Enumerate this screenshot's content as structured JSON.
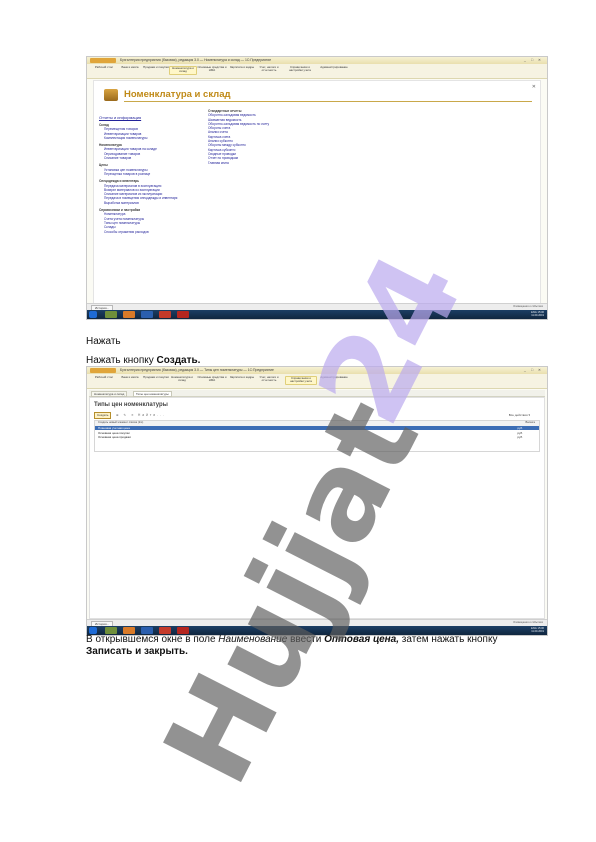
{
  "screenshot1": {
    "window_title": "Бухгалтерия предприятия (базовая), редакция 3.0 — Номенклатура и склад — 1С:Предприятие",
    "sections": [
      "Рабочий стол",
      "Банк и касса",
      "Продажи и покупки",
      "Номенклатура и склад",
      "Основные средства и НМА",
      "Зарплата и кадры",
      "Учет, налоги и отчетность",
      "Справочники и настройки учета",
      "Администрирование"
    ],
    "page_title": "Номенклатура и склад",
    "left_column": {
      "top_link": "Отчеты и информация",
      "groups": [
        {
          "heading": "Склад",
          "items": [
            "Перемещения товаров",
            "Инвентаризации товаров",
            "Комплектация номенклатуры"
          ]
        },
        {
          "heading": "Номенклатура",
          "items": [
            "Инвентаризация товаров на складе",
            "Оприходование товаров",
            "Списание товаров"
          ]
        },
        {
          "heading": "Цены",
          "items": [
            "Установка цен номенклатуры",
            "Переоценка товаров в рознице"
          ]
        },
        {
          "heading": "Спецодежда и инвентарь",
          "items": [
            "Передача материалов в эксплуатацию",
            "Возврат материалов из эксплуатации",
            "Списание материалов из эксплуатации",
            "Передача в помещения спецодежды и инвентаря",
            "Выработка материалов"
          ]
        },
        {
          "heading": "Справочники и настройки",
          "items": [
            "Номенклатура",
            "Счета учета номенклатуры",
            "Типы цен номенклатуры",
            "Склады",
            "Способы отражения расходов"
          ]
        }
      ]
    },
    "right_column": {
      "heading": "Стандартные отчеты",
      "items": [
        "Оборотно-сальдовая ведомость",
        "Шахматная ведомость",
        "Оборотно-сальдовая ведомость по счету",
        "Обороты счета",
        "Анализ счета",
        "Карточка счета",
        "Анализ субконто",
        "Обороты между субконто",
        "Карточка субконто",
        "Сводные проводки",
        "Отчет по проводкам",
        "Главная книга"
      ]
    },
    "status_left": "История...",
    "status_right": "Оповещения о событиях",
    "tray": {
      "lang": "ENG",
      "time": "15:06",
      "date": "11.09.2019"
    }
  },
  "para1": "Нажать",
  "para2": {
    "before": "Нажать кнопку ",
    "bold": "Создать."
  },
  "screenshot2": {
    "window_title": "Бухгалтерия предприятия (базовая), редакция 3.0 — Типы цен номенклатуры — 1С:Предприятие",
    "sections": [
      "Рабочий стол",
      "Банк и касса",
      "Продажи и покупки",
      "Номенклатура и склад",
      "Основные средства и НМА",
      "Зарплата и кадры",
      "Учет, налоги и отчетность",
      "Справочники и настройки учета",
      "Администрирование"
    ],
    "tabs": [
      "Номенклатура и склад",
      "Типы цен номенклатуры"
    ],
    "form_title": "Типы цен номенклатуры",
    "create_button": "Создать",
    "find_label": "Найти...",
    "more_label": "Все действия ▾",
    "columns": [
      "Создать новый элемент списка (Ins)",
      "Валюта"
    ],
    "rows": [
      {
        "name": "Плановая учетная цена",
        "currency": "руб."
      },
      {
        "name": "Основная цена покупки",
        "currency": "руб."
      },
      {
        "name": "Основная цена продажи",
        "currency": "руб."
      }
    ],
    "status_left": "История...",
    "status_right": "Оповещения о событиях",
    "tray": {
      "lang": "ENG",
      "time": "15:06",
      "date": "11.09.2019"
    }
  },
  "para3": {
    "t1": "В открывшемся окне в поле ",
    "t2": "Наименование",
    "t3": " ввести ",
    "t4": "Оптовая цена,",
    "t5": " затем нажать кнопку ",
    "t6": "Записать и закрыть."
  },
  "watermark": {
    "gray": "Hujjat",
    "violet": "24"
  }
}
